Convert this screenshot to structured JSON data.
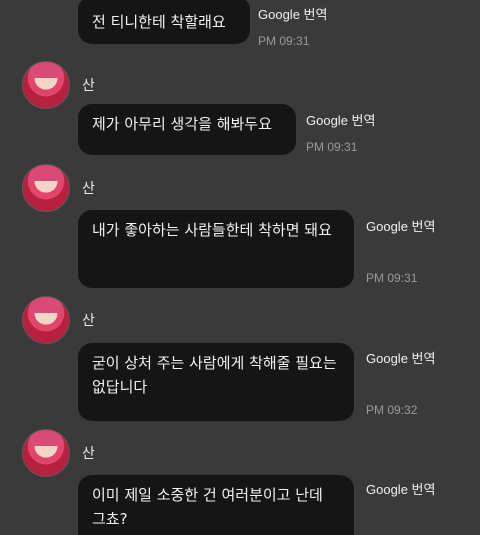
{
  "sender": {
    "name": "산"
  },
  "translate_label": "Google 번역",
  "messages": [
    {
      "text": "전 티니한테 착할래요",
      "time": "PM 09:31"
    },
    {
      "text": "제가 아무리 생각을 해봐두요",
      "time": "PM 09:31"
    },
    {
      "text": "내가 좋아하는 사람들한테 착하면 돼요",
      "time": "PM 09:31"
    },
    {
      "text": "굳이 상처 주는 사람에게 착해줄 필요는 없답니다",
      "time": "PM 09:32"
    },
    {
      "text": "이미 제일 소중한 건 여러분이고 난데 그쵸?",
      "time": ""
    }
  ]
}
